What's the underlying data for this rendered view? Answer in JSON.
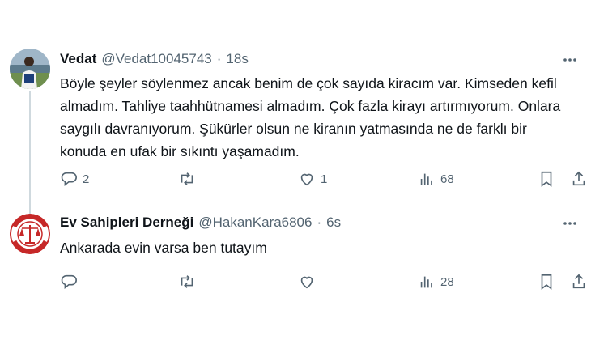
{
  "tweets": [
    {
      "author_name": "Vedat",
      "author_handle": "@Vedat10045743",
      "separator": "·",
      "time": "18s",
      "text": "Böyle şeyler söylenmez ancak benim de çok sayıda kiracım var. Kimseden kefil almadım. Tahliye taahhütnamesi almadım. Çok fazla kirayı artırmıyorum. Onlara saygılı davranıyorum. Şükürler olsun ne kiranın yatmasında ne de farklı bir konuda en ufak bir sıkıntı yaşamadım.",
      "reply_count": "2",
      "retweet_count": "",
      "like_count": "1",
      "view_count": "68"
    },
    {
      "author_name": "Ev Sahipleri Derneği",
      "author_handle": "@HakanKara6806",
      "separator": "·",
      "time": "6s",
      "text": "Ankarada evin varsa ben tutayım",
      "reply_count": "",
      "retweet_count": "",
      "like_count": "",
      "view_count": "28"
    }
  ],
  "icons": {
    "reply": "reply-icon",
    "retweet": "retweet-icon",
    "like": "heart-icon",
    "views": "views-icon",
    "bookmark": "bookmark-icon",
    "share": "share-icon",
    "more": "more-icon"
  },
  "colors": {
    "text_primary": "#0f1419",
    "text_secondary": "#536471",
    "thread_line": "#cfd9de"
  }
}
